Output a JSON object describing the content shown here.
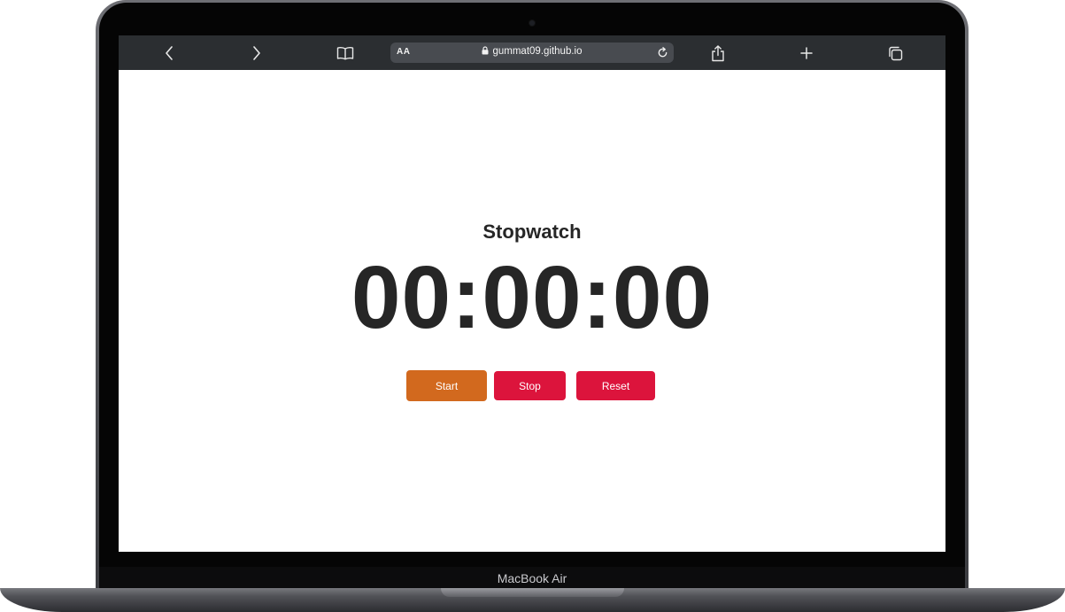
{
  "device": {
    "label": "MacBook Air"
  },
  "browser": {
    "reader_label": "AA",
    "url": "gummat09.github.io",
    "icons": {
      "back": "chevron-left-icon",
      "forward": "chevron-right-icon",
      "bookmarks": "book-icon",
      "lock": "lock-icon",
      "reload": "reload-icon",
      "share": "share-icon",
      "new_tab": "plus-icon",
      "tabs": "tabs-icon"
    },
    "colors": {
      "toolbar": "#2b2e31",
      "urlbar": "#484b50"
    }
  },
  "page": {
    "title": "Stopwatch",
    "time": "00:00:00",
    "buttons": {
      "start": "Start",
      "stop": "Stop",
      "reset": "Reset"
    },
    "colors": {
      "text": "#262626",
      "start": "#d2691e",
      "stop": "#dc143c",
      "reset": "#dc143c"
    }
  }
}
